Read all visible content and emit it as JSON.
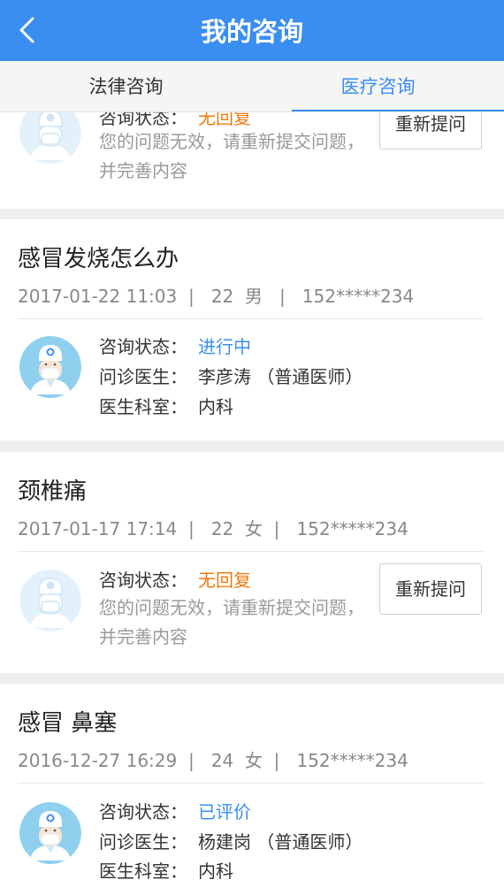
{
  "header": {
    "title": "我的咨询"
  },
  "tabs": [
    {
      "label": "法律咨询"
    },
    {
      "label": "医疗咨询"
    }
  ],
  "labels": {
    "status": "咨询状态：",
    "doctor": "问诊医生：",
    "dept": "医生科室："
  },
  "cards": [
    {
      "status": "无回复",
      "desc": "您的问题无效，请重新提交问题，并完善内容",
      "button": "重新提问"
    },
    {
      "title": "感冒发烧怎么办",
      "meta": "2017-01-22 11:03  |   22  男   |   152*****234",
      "status": "进行中",
      "doctor": "李彦涛 （普通医师）",
      "dept": "内科"
    },
    {
      "title": "颈椎痛",
      "meta": "2017-01-17 17:14  |   22  女  |   152*****234",
      "status": "无回复",
      "desc": "您的问题无效，请重新提交问题，并完善内容",
      "button": "重新提问"
    },
    {
      "title": "感冒 鼻塞",
      "meta": "2016-12-27 16:29  |   24  女  |   152*****234",
      "status": "已评价",
      "doctor": "杨建岗 （普通医师）",
      "dept": "内科"
    }
  ],
  "colors": {
    "accent": "#3a8ef0",
    "warning": "#f07a0c"
  }
}
